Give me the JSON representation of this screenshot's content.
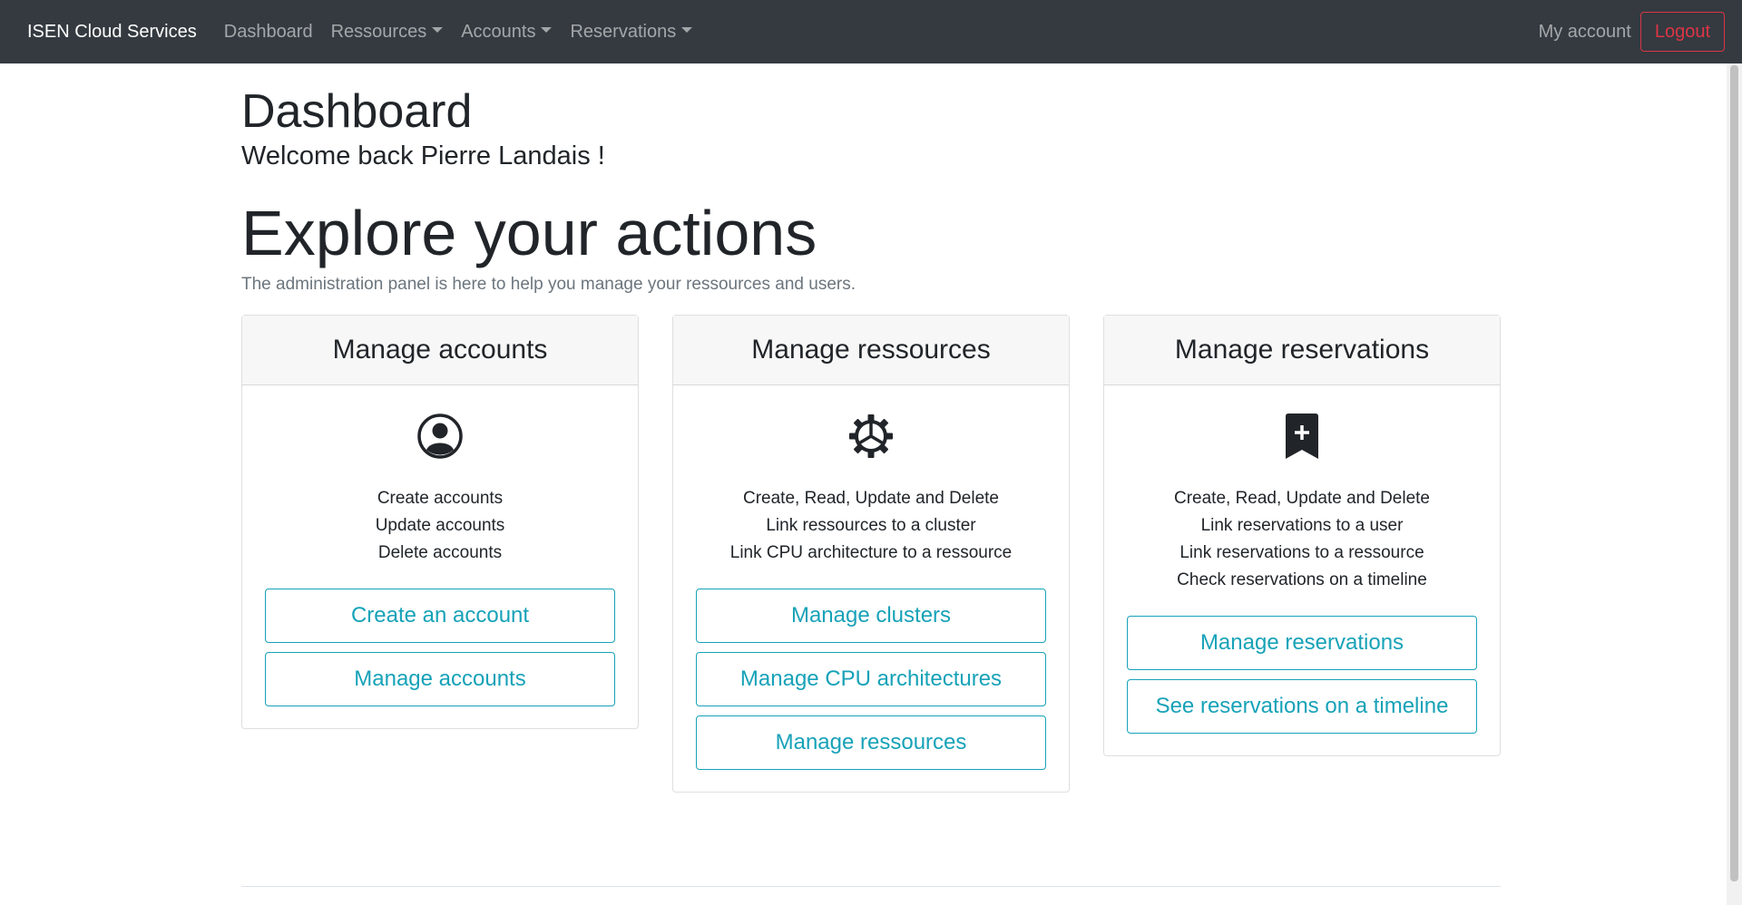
{
  "navbar": {
    "brand": "ISEN Cloud Services",
    "links": [
      {
        "label": "Dashboard",
        "dropdown": false
      },
      {
        "label": "Ressources",
        "dropdown": true
      },
      {
        "label": "Accounts",
        "dropdown": true
      },
      {
        "label": "Reservations",
        "dropdown": true
      }
    ],
    "my_account": "My account",
    "logout": "Logout"
  },
  "page": {
    "title": "Dashboard",
    "welcome": "Welcome back Pierre Landais !",
    "explore_title": "Explore your actions",
    "lead": "The administration panel is here to help you manage your ressources and users."
  },
  "cards": [
    {
      "title": "Manage accounts",
      "icon": "user-circle-icon",
      "features": [
        "Create accounts",
        "Update accounts",
        "Delete accounts"
      ],
      "buttons": [
        "Create an account",
        "Manage accounts"
      ]
    },
    {
      "title": "Manage ressources",
      "icon": "gear-icon",
      "features": [
        "Create, Read, Update and Delete",
        "Link ressources to a cluster",
        "Link CPU architecture to a ressource"
      ],
      "buttons": [
        "Manage clusters",
        "Manage CPU architectures",
        "Manage ressources"
      ]
    },
    {
      "title": "Manage reservations",
      "icon": "bookmark-plus-icon",
      "features": [
        "Create, Read, Update and Delete",
        "Link reservations to a user",
        "Link reservations to a ressource",
        "Check reservations on a timeline"
      ],
      "buttons": [
        "Manage reservations",
        "See reservations on a timeline"
      ]
    }
  ],
  "colors": {
    "navbar_bg": "#343a40",
    "logout": "#dc3545",
    "accent": "#17a2b8"
  }
}
